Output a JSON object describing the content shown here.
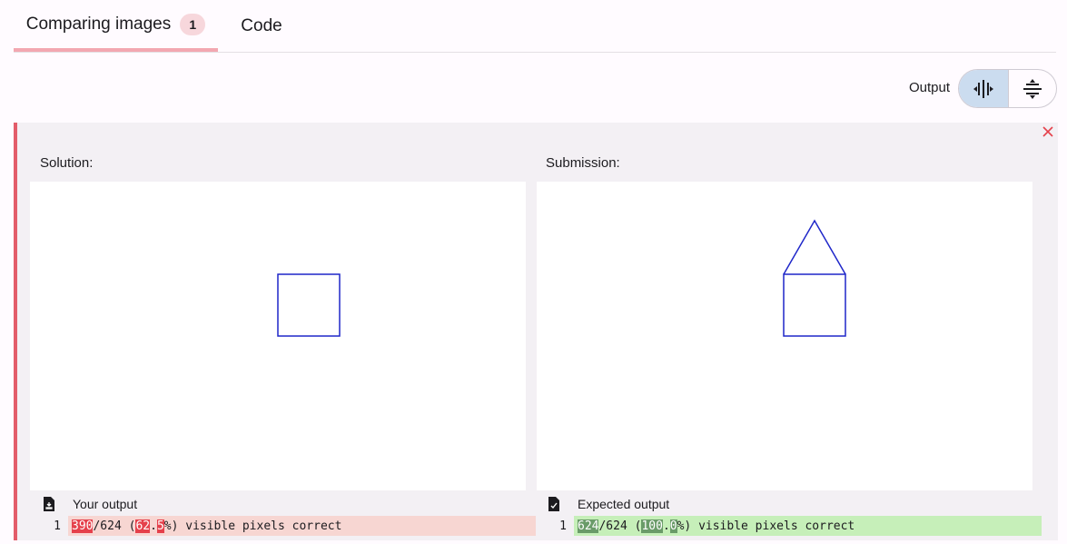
{
  "tabs": {
    "comparing_label": "Comparing images",
    "comparing_badge": "1",
    "code_label": "Code"
  },
  "toolbar": {
    "output_label": "Output",
    "modes": [
      "side-by-side-icon",
      "stacked-icon"
    ],
    "selected_mode": "side-by-side"
  },
  "panel": {
    "status_color": "#e35d6a",
    "solution_label": "Solution:",
    "submission_label": "Submission:",
    "your_output_label": "Your output",
    "expected_output_label": "Expected output",
    "your_output_line": {
      "line_no": "1",
      "correct": "390",
      "total": "/624",
      "pct_open": " (",
      "pct_int": "62",
      "pct_dot": ".",
      "pct_dec": "5",
      "suffix": "%) visible pixels correct"
    },
    "expected_output_line": {
      "line_no": "1",
      "correct": "624",
      "total": "/624",
      "pct_open": " (",
      "pct_int": "100",
      "pct_dot": ".",
      "pct_dec": "0",
      "suffix": "%) visible pixels correct"
    },
    "shape_color": "#1f27c9"
  }
}
